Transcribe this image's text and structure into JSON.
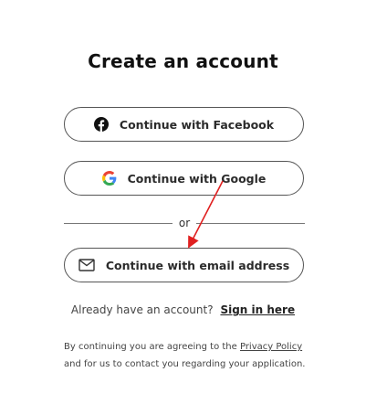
{
  "heading": "Create an account",
  "buttons": {
    "facebook_label": "Continue with Facebook",
    "google_label": "Continue with Google",
    "email_label": "Continue with email address"
  },
  "divider_text": "or",
  "signin": {
    "prompt": "Already have an account?",
    "link_label": "Sign in here"
  },
  "legal": {
    "prefix": "By continuing you are agreeing to the",
    "link_label": "Privacy Policy",
    "suffix": "and for us to contact you regarding your application."
  },
  "icons": {
    "facebook": "facebook-icon",
    "google": "google-icon",
    "email": "envelope-icon"
  },
  "colors": {
    "annotation_arrow": "#e02020",
    "facebook_icon": "#111111",
    "google_blue": "#4285F4",
    "google_red": "#EA4335",
    "google_yellow": "#FBBC05",
    "google_green": "#34A853"
  }
}
